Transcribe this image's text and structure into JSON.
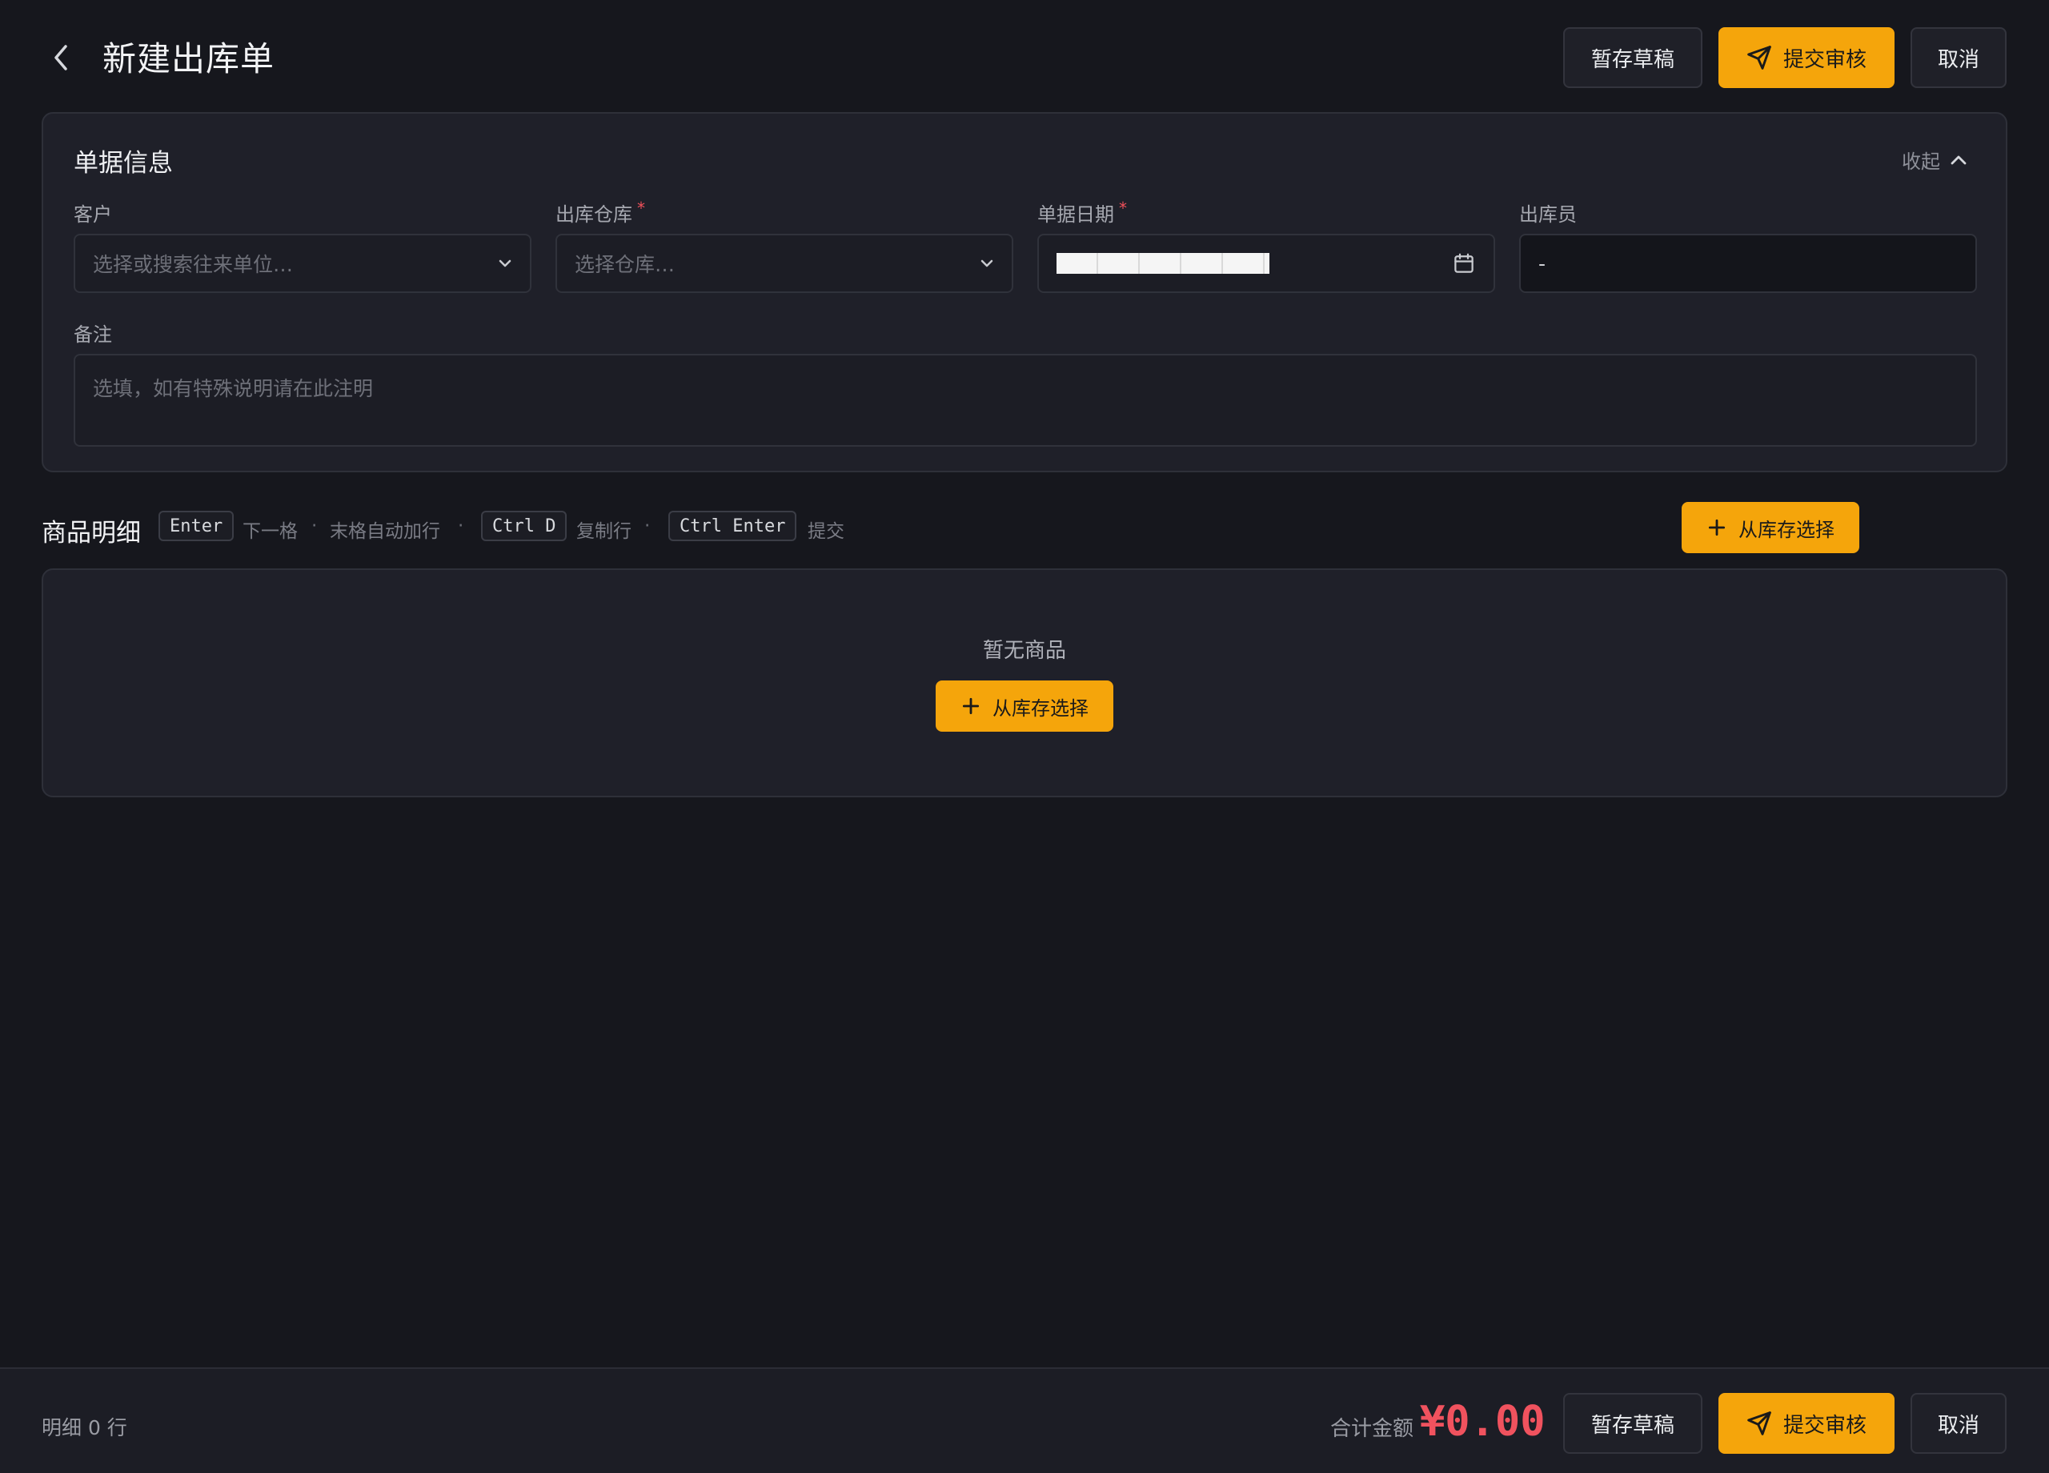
{
  "header": {
    "title": "新建出库单",
    "save_draft": "暂存草稿",
    "submit": "提交审核",
    "cancel": "取消"
  },
  "doc_info": {
    "title": "单据信息",
    "collapse": "收起",
    "customer_label": "客户",
    "customer_placeholder": "选择或搜索往来单位…",
    "warehouse_label": "出库仓库",
    "warehouse_placeholder": "选择仓库…",
    "date_label": "单据日期",
    "operator_label": "出库员",
    "operator_value": "-",
    "remark_label": "备注",
    "remark_placeholder": "选填，如有特殊说明请在此注明",
    "required_mark": "*"
  },
  "items": {
    "title": "商品明细",
    "kbd_enter": "Enter",
    "hint_next": "下一格",
    "hint_autorow": "末格自动加行",
    "kbd_ctrl_d": "Ctrl D",
    "hint_copy": "复制行",
    "kbd_ctrl_enter": "Ctrl Enter",
    "hint_submit": "提交",
    "separator": "·",
    "pick_from_stock": "从库存选择",
    "empty_text": "暂无商品"
  },
  "footer": {
    "row_count": "明细 0 行",
    "total_label": "合计金额",
    "total_value": "¥0.00",
    "save_draft": "暂存草稿",
    "submit": "提交审核",
    "cancel": "取消"
  },
  "colors": {
    "accent": "#f5a50b",
    "danger": "#f0525e",
    "background": "#16171d",
    "card": "#1f2029"
  }
}
